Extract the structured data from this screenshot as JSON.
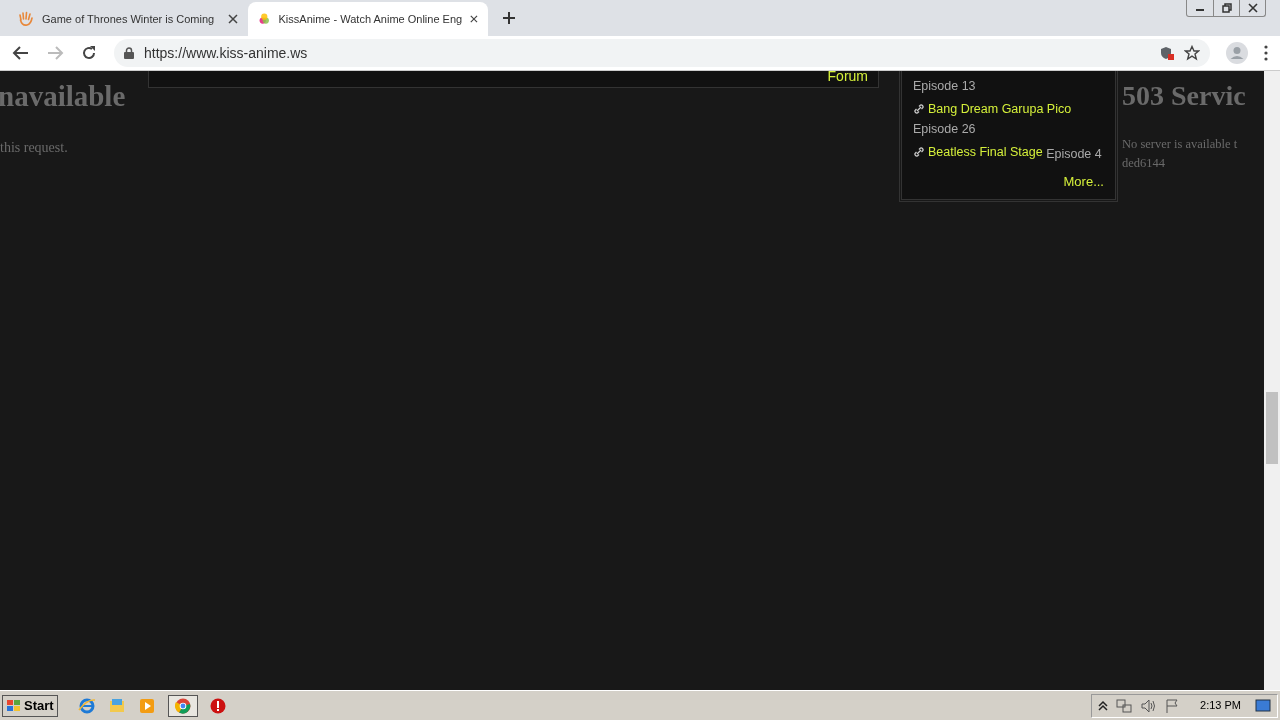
{
  "tabs": [
    {
      "title": "Game of Thrones Winter is Coming",
      "selected": false
    },
    {
      "title": "KissAnime - Watch Anime Online Eng",
      "selected": true
    }
  ],
  "address_bar": {
    "url": "https://www.kiss-anime.ws"
  },
  "page": {
    "left": {
      "heading": "navailable",
      "text": "this request."
    },
    "top_box": {
      "link": "Forum"
    },
    "panel": {
      "items": [
        {
          "episode": "Episode 13"
        },
        {
          "title": "Bang Dream Garupa Pico",
          "episode": "Episode 26"
        },
        {
          "title": "Beatless Final Stage",
          "episode": "Episode 4"
        }
      ],
      "more": "More..."
    },
    "right": {
      "heading": "503 Servic",
      "lines": [
        "No server is available t",
        "ded6144"
      ]
    }
  },
  "taskbar": {
    "start": "Start",
    "clock": "2:13 PM"
  }
}
